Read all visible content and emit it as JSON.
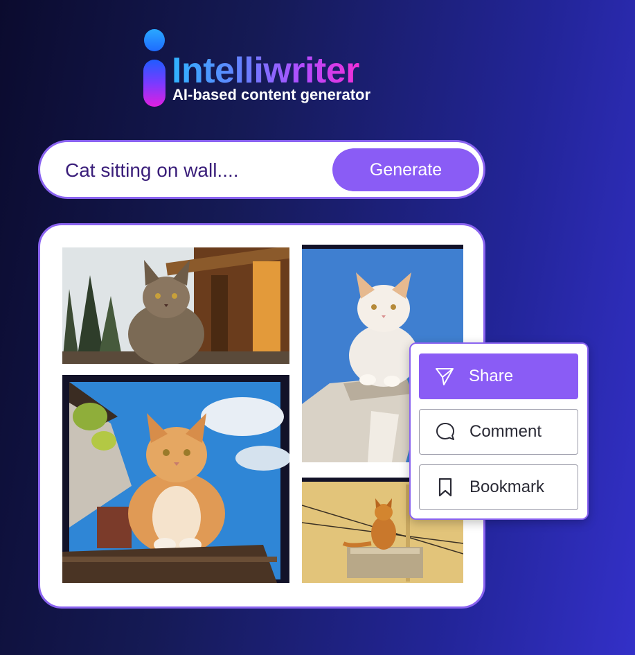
{
  "brand": {
    "title": "Intelliwriter",
    "subtitle": "AI-based content generator"
  },
  "search": {
    "value": "Cat sitting on wall....",
    "button_label": "Generate"
  },
  "gallery": {
    "images": [
      "cat-on-wooden-house",
      "white-cat-blue-sky",
      "orange-cat-on-roof",
      "orange-cat-on-yellow-wall"
    ]
  },
  "menu": {
    "items": [
      {
        "label": "Share",
        "icon": "send-icon",
        "active": true
      },
      {
        "label": "Comment",
        "icon": "comment-icon",
        "active": false
      },
      {
        "label": "Bookmark",
        "icon": "bookmark-icon",
        "active": false
      }
    ]
  },
  "colors": {
    "accent": "#8a5cf5",
    "border": "#8a63f0"
  }
}
